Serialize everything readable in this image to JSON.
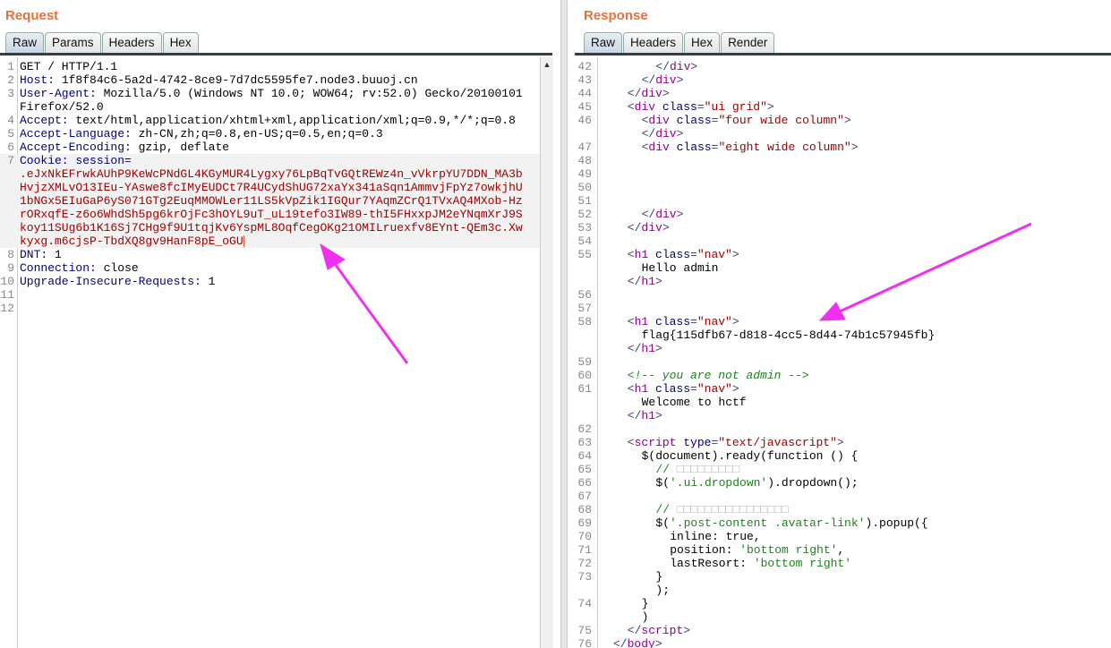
{
  "request": {
    "title": "Request",
    "tabs": [
      "Raw",
      "Params",
      "Headers",
      "Hex"
    ],
    "active_tab": "Raw",
    "lines": [
      [
        "1",
        [
          [
            "x",
            "GET / HTTP/1.1"
          ]
        ]
      ],
      [
        "2",
        [
          [
            "n",
            "Host: "
          ],
          [
            "x",
            "1f8f84c6-5a2d-4742-8ce9-7d7dc5595fe7.node3.buuoj.cn"
          ]
        ]
      ],
      [
        "3",
        [
          [
            "n",
            "User-Agent: "
          ],
          [
            "x",
            "Mozilla/5.0 (Windows NT 10.0; WOW64; rv:52.0) Gecko/20100101"
          ]
        ]
      ],
      [
        "",
        [
          [
            "x",
            "Firefox/52.0"
          ]
        ]
      ],
      [
        "4",
        [
          [
            "n",
            "Accept: "
          ],
          [
            "x",
            "text/html,application/xhtml+xml,application/xml;q=0.9,*/*;q=0.8"
          ]
        ]
      ],
      [
        "5",
        [
          [
            "n",
            "Accept-Language: "
          ],
          [
            "x",
            "zh-CN,zh;q=0.8,en-US;q=0.5,en;q=0.3"
          ]
        ]
      ],
      [
        "6",
        [
          [
            "n",
            "Accept-Encoding: "
          ],
          [
            "x",
            "gzip, deflate"
          ]
        ]
      ],
      [
        "7",
        [
          [
            "n",
            "Cookie: session="
          ]
        ]
      ],
      [
        "",
        [
          [
            "v",
            ".eJxNkEFrwkAUhP9KeWcPNdGL4KGyMUR4Lygxy76LpBqTvGQtREWz4n_vVkrpYU7DDN_MA3b"
          ]
        ]
      ],
      [
        "",
        [
          [
            "v",
            "HvjzXMLvO13IEu-YAswe8fcIMyEUDCt7R4UCydShUG72xaYx341aSqn1AmmvjFpYz7owkjhU"
          ]
        ]
      ],
      [
        "",
        [
          [
            "v",
            "1bNGx5EIuGaP6yS071GTg2EuqMMOWLer11LS5kVpZik1IGQur7YAqmZCrQ1TVxAQ4MXob-Hz"
          ]
        ]
      ],
      [
        "",
        [
          [
            "v",
            "rORxqfE-z6o6WhdSh5pg6krOjFc3hOYL9uT_uL19tefo3IW89-thI5FHxxpJM2eYNqmXrJ9S"
          ]
        ]
      ],
      [
        "",
        [
          [
            "v",
            "koy11SUg6b1K16Sj7CHg9f9U1tqjKv6YspML8OqfCegOKg21OMILruexfv8EYnt-QEm3c.Xw"
          ]
        ]
      ],
      [
        "",
        [
          [
            "v",
            "kyxg.m6cjsP-TbdXQ8gv9HanF8pE_oGU"
          ]
        ]
      ],
      [
        "8",
        [
          [
            "n",
            "DNT: "
          ],
          [
            "x",
            "1"
          ]
        ]
      ],
      [
        "9",
        [
          [
            "n",
            "Connection: "
          ],
          [
            "x",
            "close"
          ]
        ]
      ],
      [
        "10",
        [
          [
            "n",
            "Upgrade-Insecure-Requests: "
          ],
          [
            "x",
            "1"
          ]
        ]
      ],
      [
        "11",
        []
      ],
      [
        "12",
        []
      ]
    ]
  },
  "response": {
    "title": "Response",
    "tabs": [
      "Raw",
      "Headers",
      "Hex",
      "Render"
    ],
    "active_tab": "Raw",
    "lines": [
      [
        "42",
        6,
        [
          [
            "p",
            "</"
          ],
          [
            "t",
            "div"
          ],
          [
            "p",
            ">"
          ]
        ]
      ],
      [
        "43",
        4,
        [
          [
            "p",
            "</"
          ],
          [
            "t",
            "div"
          ],
          [
            "p",
            ">"
          ]
        ]
      ],
      [
        "44",
        2,
        [
          [
            "p",
            "</"
          ],
          [
            "t",
            "div"
          ],
          [
            "p",
            ">"
          ]
        ]
      ],
      [
        "45",
        2,
        [
          [
            "p",
            "<"
          ],
          [
            "t",
            "div "
          ],
          [
            "a",
            "class"
          ],
          [
            "p",
            "="
          ],
          [
            "v",
            "\"ui grid\""
          ],
          [
            "p",
            ">"
          ]
        ]
      ],
      [
        "46",
        4,
        [
          [
            "p",
            "<"
          ],
          [
            "t",
            "div "
          ],
          [
            "a",
            "class"
          ],
          [
            "p",
            "="
          ],
          [
            "v",
            "\"four wide column\""
          ],
          [
            "p",
            ">"
          ]
        ]
      ],
      [
        "",
        4,
        [
          [
            "p",
            "</"
          ],
          [
            "t",
            "div"
          ],
          [
            "p",
            ">"
          ]
        ]
      ],
      [
        "47",
        4,
        [
          [
            "p",
            "<"
          ],
          [
            "t",
            "div "
          ],
          [
            "a",
            "class"
          ],
          [
            "p",
            "="
          ],
          [
            "v",
            "\"eight wide column\""
          ],
          [
            "p",
            ">"
          ]
        ]
      ],
      [
        "48",
        0,
        []
      ],
      [
        "49",
        0,
        []
      ],
      [
        "50",
        0,
        []
      ],
      [
        "51",
        0,
        []
      ],
      [
        "52",
        4,
        [
          [
            "p",
            "</"
          ],
          [
            "t",
            "div"
          ],
          [
            "p",
            ">"
          ]
        ]
      ],
      [
        "53",
        2,
        [
          [
            "p",
            "</"
          ],
          [
            "t",
            "div"
          ],
          [
            "p",
            ">"
          ]
        ]
      ],
      [
        "54",
        0,
        []
      ],
      [
        "55",
        2,
        [
          [
            "p",
            "<"
          ],
          [
            "t",
            "h1 "
          ],
          [
            "a",
            "class"
          ],
          [
            "p",
            "="
          ],
          [
            "v",
            "\"nav\""
          ],
          [
            "p",
            ">"
          ]
        ]
      ],
      [
        "",
        4,
        [
          [
            "x",
            "Hello admin"
          ]
        ]
      ],
      [
        "",
        2,
        [
          [
            "p",
            "</"
          ],
          [
            "t",
            "h1"
          ],
          [
            "p",
            ">"
          ]
        ]
      ],
      [
        "56",
        0,
        []
      ],
      [
        "57",
        0,
        []
      ],
      [
        "58",
        2,
        [
          [
            "p",
            "<"
          ],
          [
            "t",
            "h1 "
          ],
          [
            "a",
            "class"
          ],
          [
            "p",
            "="
          ],
          [
            "v",
            "\"nav\""
          ],
          [
            "p",
            ">"
          ]
        ]
      ],
      [
        "",
        4,
        [
          [
            "x",
            "flag{115dfb67-d818-4cc5-8d44-74b1c57945fb}"
          ]
        ]
      ],
      [
        "",
        2,
        [
          [
            "p",
            "</"
          ],
          [
            "t",
            "h1"
          ],
          [
            "p",
            ">"
          ]
        ]
      ],
      [
        "59",
        0,
        []
      ],
      [
        "60",
        2,
        [
          [
            "c",
            "<!-- you are not admin -->"
          ]
        ]
      ],
      [
        "61",
        2,
        [
          [
            "p",
            "<"
          ],
          [
            "t",
            "h1 "
          ],
          [
            "a",
            "class"
          ],
          [
            "p",
            "="
          ],
          [
            "v",
            "\"nav\""
          ],
          [
            "p",
            ">"
          ]
        ]
      ],
      [
        "",
        4,
        [
          [
            "x",
            "Welcome to hctf"
          ]
        ]
      ],
      [
        "",
        2,
        [
          [
            "p",
            "</"
          ],
          [
            "t",
            "h1"
          ],
          [
            "p",
            ">"
          ]
        ]
      ],
      [
        "62",
        0,
        []
      ],
      [
        "63",
        2,
        [
          [
            "p",
            "<"
          ],
          [
            "t",
            "script "
          ],
          [
            "a",
            "type"
          ],
          [
            "p",
            "="
          ],
          [
            "v",
            "\"text/javascript\""
          ],
          [
            "p",
            ">"
          ]
        ]
      ],
      [
        "64",
        4,
        [
          [
            "x",
            "$(document).ready(function () {"
          ]
        ]
      ],
      [
        "65",
        6,
        [
          [
            "s",
            "// "
          ],
          [
            "box",
            "□□□□□□□□□"
          ]
        ]
      ],
      [
        "66",
        6,
        [
          [
            "x",
            "$("
          ],
          [
            "s",
            "'.ui.dropdown'"
          ],
          [
            "x",
            ").dropdown();"
          ]
        ]
      ],
      [
        "67",
        0,
        []
      ],
      [
        "68",
        6,
        [
          [
            "s",
            "// "
          ],
          [
            "box",
            "□□□□□□□□□□□□□□□□"
          ]
        ]
      ],
      [
        "69",
        6,
        [
          [
            "x",
            "$("
          ],
          [
            "s",
            "'.post-content .avatar-link'"
          ],
          [
            "x",
            ").popup({"
          ]
        ]
      ],
      [
        "70",
        8,
        [
          [
            "x",
            "inline: true,"
          ]
        ]
      ],
      [
        "71",
        8,
        [
          [
            "x",
            "position: "
          ],
          [
            "s",
            "'bottom right'"
          ],
          [
            "x",
            ","
          ]
        ]
      ],
      [
        "72",
        8,
        [
          [
            "x",
            "lastResort: "
          ],
          [
            "s",
            "'bottom right'"
          ]
        ]
      ],
      [
        "73",
        6,
        [
          [
            "x",
            "}"
          ]
        ]
      ],
      [
        "",
        6,
        [
          [
            "x",
            ");"
          ]
        ]
      ],
      [
        "74",
        4,
        [
          [
            "x",
            "}"
          ]
        ]
      ],
      [
        "",
        4,
        [
          [
            "x",
            ")"
          ]
        ]
      ],
      [
        "75",
        2,
        [
          [
            "p",
            "</"
          ],
          [
            "t",
            "script"
          ],
          [
            "p",
            ">"
          ]
        ]
      ],
      [
        "76",
        0,
        [
          [
            "p",
            "</"
          ],
          [
            "t",
            "body"
          ],
          [
            "p",
            ">"
          ]
        ]
      ]
    ]
  },
  "colors": {
    "title": "#e8703a",
    "arrow": "#f030f0"
  }
}
